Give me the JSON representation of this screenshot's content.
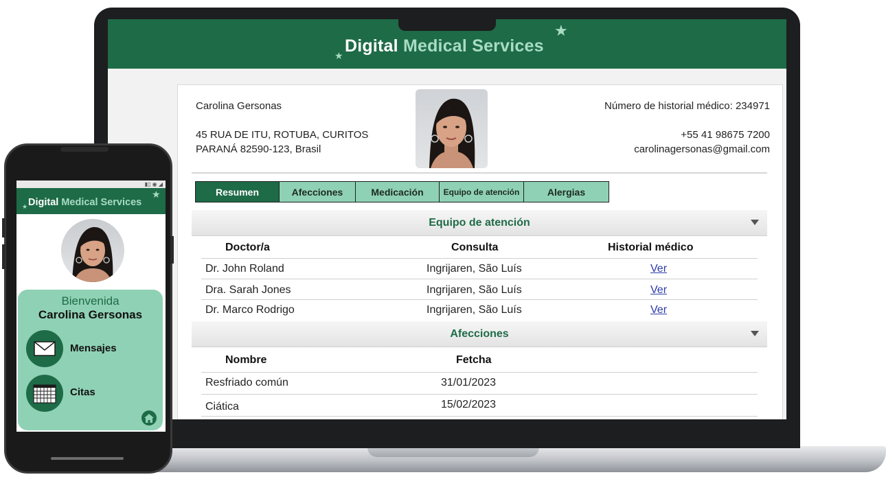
{
  "app": {
    "brand_word1": "Digital",
    "brand_word2": "Medical Services",
    "colors": {
      "primary": "#1e6b47",
      "accent": "#8fd1b4",
      "link": "#2b3aa8"
    }
  },
  "patient": {
    "name": "Carolina Gersonas",
    "address_line1": "45 RUA DE ITU, ROTUBA, CURITOS",
    "address_line2": "PARANÁ 82590-123, Brasil",
    "record_number": "Número de historial médico: 234971",
    "phone": "+55 41 98675 7200",
    "email": "carolinagersonas@gmail.com"
  },
  "tabs": [
    {
      "label": "Resumen",
      "active": true
    },
    {
      "label": "Afecciones",
      "active": false
    },
    {
      "label": "Medicación",
      "active": false
    },
    {
      "label": "Equipo de atención",
      "active": false
    },
    {
      "label": "Alergias",
      "active": false
    }
  ],
  "care_team": {
    "title": "Equipo de atención",
    "columns": [
      "Doctor/a",
      "Consulta",
      "Historial médico"
    ],
    "rows": [
      {
        "doctor": "Dr. John Roland",
        "office": "Ingrijaren, São Luís",
        "record": "Ver"
      },
      {
        "doctor": "Dra. Sarah Jones",
        "office": "Ingrijaren, São Luís",
        "record": "Ver"
      },
      {
        "doctor": "Dr. Marco Rodrigo",
        "office": "Ingrijaren, São Luís",
        "record": "Ver"
      }
    ]
  },
  "conditions": {
    "title": "Afecciones",
    "columns": [
      "Nombre",
      "Fetcha"
    ],
    "rows": [
      {
        "name": "Resfriado común",
        "date": "31/01/2023"
      },
      {
        "name": "Ciática",
        "date": "15/02/2023"
      }
    ]
  },
  "mobile": {
    "welcome": "Bienvenida",
    "user_name": "Carolina Gersonas",
    "menu": [
      {
        "label": "Mensajes",
        "icon": "envelope-icon"
      },
      {
        "label": "Citas",
        "icon": "calendar-icon"
      }
    ]
  }
}
